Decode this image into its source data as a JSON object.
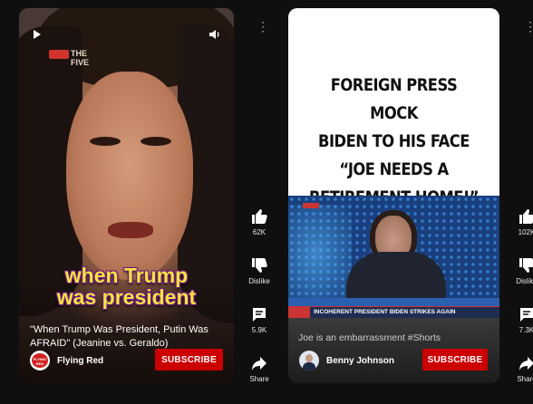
{
  "short1": {
    "logo_text": "THE FIVE",
    "caption_line1": "when Trump",
    "caption_line2": "was president",
    "title": "\"When Trump Was President, Putin Was AFRAID\" (Jeanine vs. Geraldo)",
    "channel": "Flying Red",
    "avatar_text": "FLYING RED",
    "subscribe": "SUBSCRIBE",
    "actions": {
      "like": "62K",
      "dislike": "Dislike",
      "comments": "5.9K",
      "share": "Share"
    },
    "more": "⋮"
  },
  "short2": {
    "headline_lines": [
      "FOREIGN PRESS MOCK",
      "BIDEN TO HIS FACE",
      "“JOE NEEDS A",
      "RETIREMENT HOME!”"
    ],
    "ticker": "INCOHERENT PRESIDENT BIDEN STRIKES AGAIN",
    "title": "Joe is an embarrassment #Shorts",
    "channel": "Benny Johnson",
    "subscribe": "SUBSCRIBE",
    "actions": {
      "like": "102K",
      "dislike": "Dislike",
      "comments": "7.3K",
      "share": "Share"
    },
    "more": "⋮"
  },
  "colors": {
    "background": "#0f0f0f",
    "subscribe": "#cc0000",
    "caption": "#f7e33a"
  }
}
